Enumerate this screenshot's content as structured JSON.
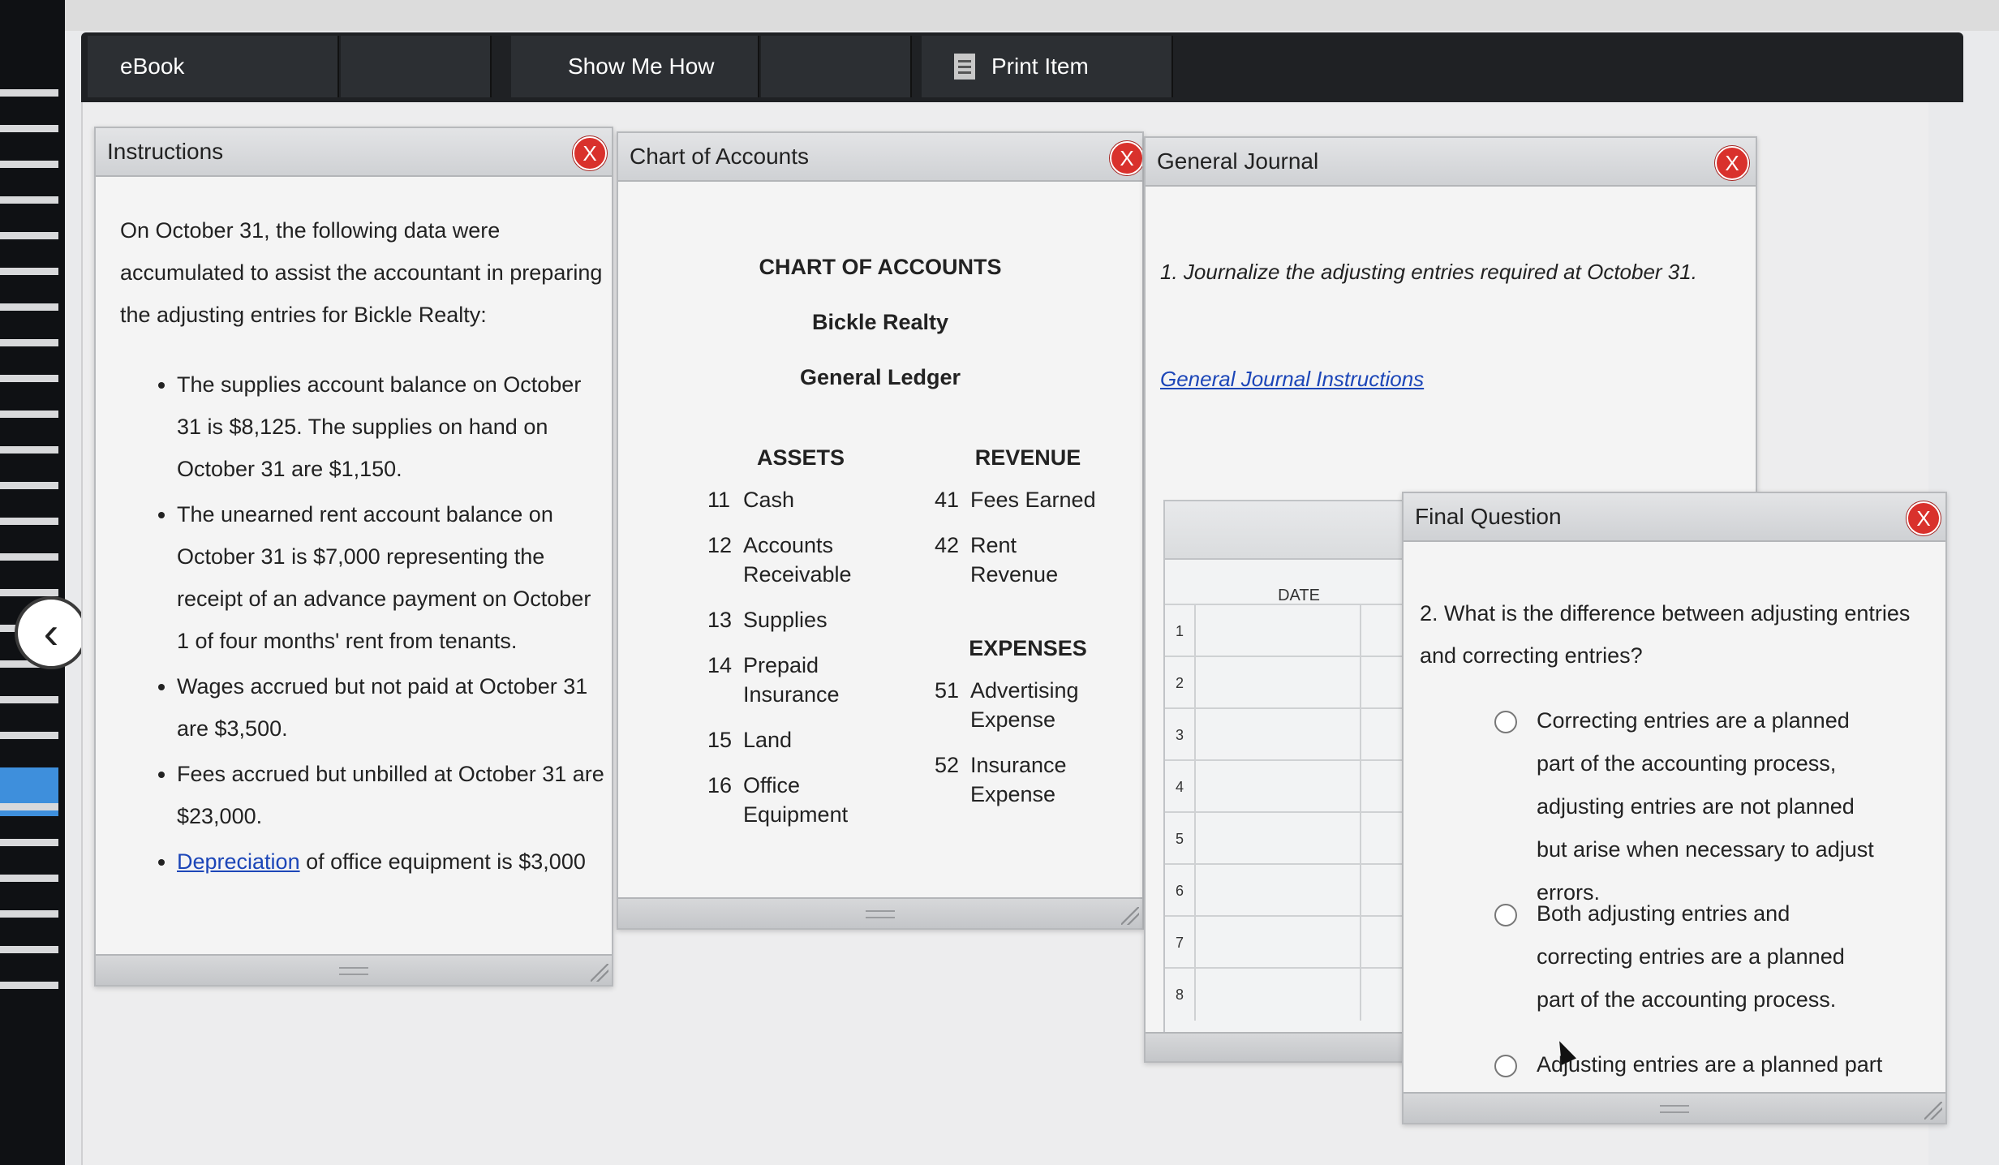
{
  "toolbar": {
    "ebook": "eBook",
    "show_me_how": "Show Me How",
    "print_item": "Print Item"
  },
  "instructions": {
    "title": "Instructions",
    "intro": "On October 31, the following data were accumulated to assist the accountant in preparing the adjusting entries for Bickle Realty:",
    "items": [
      "The supplies account balance on October 31 is $8,125. The supplies on hand on October 31 are $1,150.",
      "The unearned rent account balance on October 31 is $7,000 representing the receipt of an advance payment on October 1 of four months' rent from tenants.",
      "Wages accrued but not paid at October 31 are $3,500.",
      "Fees accrued but unbilled at October 31 are $23,000."
    ],
    "last_item_link": "Depreciation",
    "last_item_rest": " of office equipment is",
    "last_item_cut": "$3,000"
  },
  "chart_of_accounts": {
    "title": "Chart of Accounts",
    "heading": "CHART OF ACCOUNTS",
    "company": "Bickle Realty",
    "ledger": "General Ledger",
    "assets_heading": "ASSETS",
    "assets": [
      {
        "num": "11",
        "name": "Cash"
      },
      {
        "num": "12",
        "name": "Accounts Receivable"
      },
      {
        "num": "13",
        "name": "Supplies"
      },
      {
        "num": "14",
        "name": "Prepaid Insurance"
      },
      {
        "num": "15",
        "name": "Land"
      },
      {
        "num": "16",
        "name": "Office Equipment"
      }
    ],
    "revenue_heading": "REVENUE",
    "revenue": [
      {
        "num": "41",
        "name": "Fees Earned"
      },
      {
        "num": "42",
        "name": "Rent Revenue"
      }
    ],
    "expenses_heading": "EXPENSES",
    "expenses": [
      {
        "num": "51",
        "name": "Advertising Expense"
      },
      {
        "num": "52",
        "name": "Insurance Expense"
      }
    ]
  },
  "general_journal": {
    "title": "General Journal",
    "prompt": "1. Journalize the adjusting entries required at October 31.",
    "link": "General Journal Instructions",
    "date_header": "DATE",
    "rows": [
      "1",
      "2",
      "3",
      "4",
      "5",
      "6",
      "7",
      "8"
    ]
  },
  "final_question": {
    "title": "Final Question",
    "question": "2. What is the difference between adjusting entries and correcting entries?",
    "options": [
      "Correcting entries are a planned part of the accounting process, adjusting entries are not planned but arise when necessary to adjust errors.",
      "Both adjusting entries and correcting entries are a planned part of the accounting process.",
      "Adjusting entries are a planned part"
    ]
  },
  "close_symbol": "X"
}
